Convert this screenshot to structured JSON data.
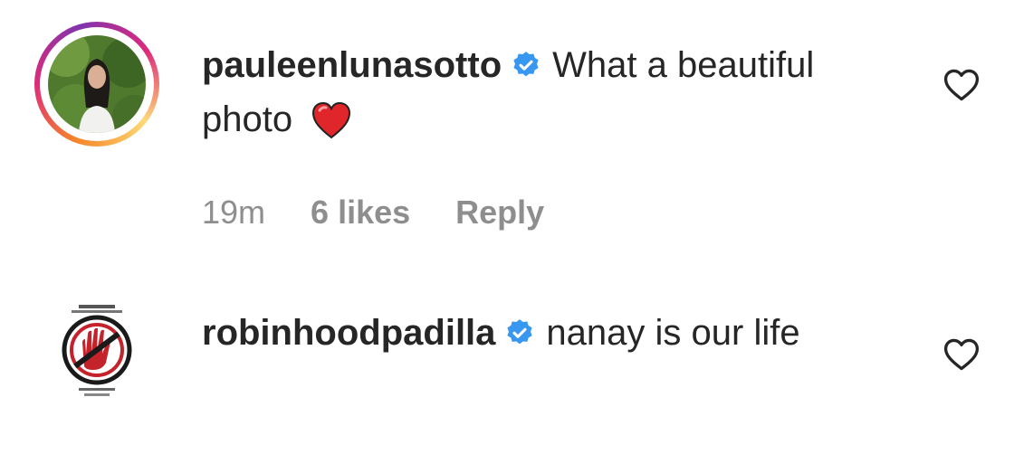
{
  "comments": [
    {
      "username": "pauleenlunasotto",
      "text": "What a beautiful photo",
      "emoji": "red-heart",
      "time": "19m",
      "likes": "6 likes",
      "reply_label": "Reply",
      "verified": true
    },
    {
      "username": "robinhoodpadilla",
      "text": "nanay is our life",
      "verified": true
    }
  ],
  "colors": {
    "verified_badge": "#3897f0",
    "meta_text": "#8e8e8e",
    "heart_emoji": "#e0252b"
  },
  "icons": {
    "like": "heart-outline-icon",
    "verified": "verified-badge-icon"
  }
}
